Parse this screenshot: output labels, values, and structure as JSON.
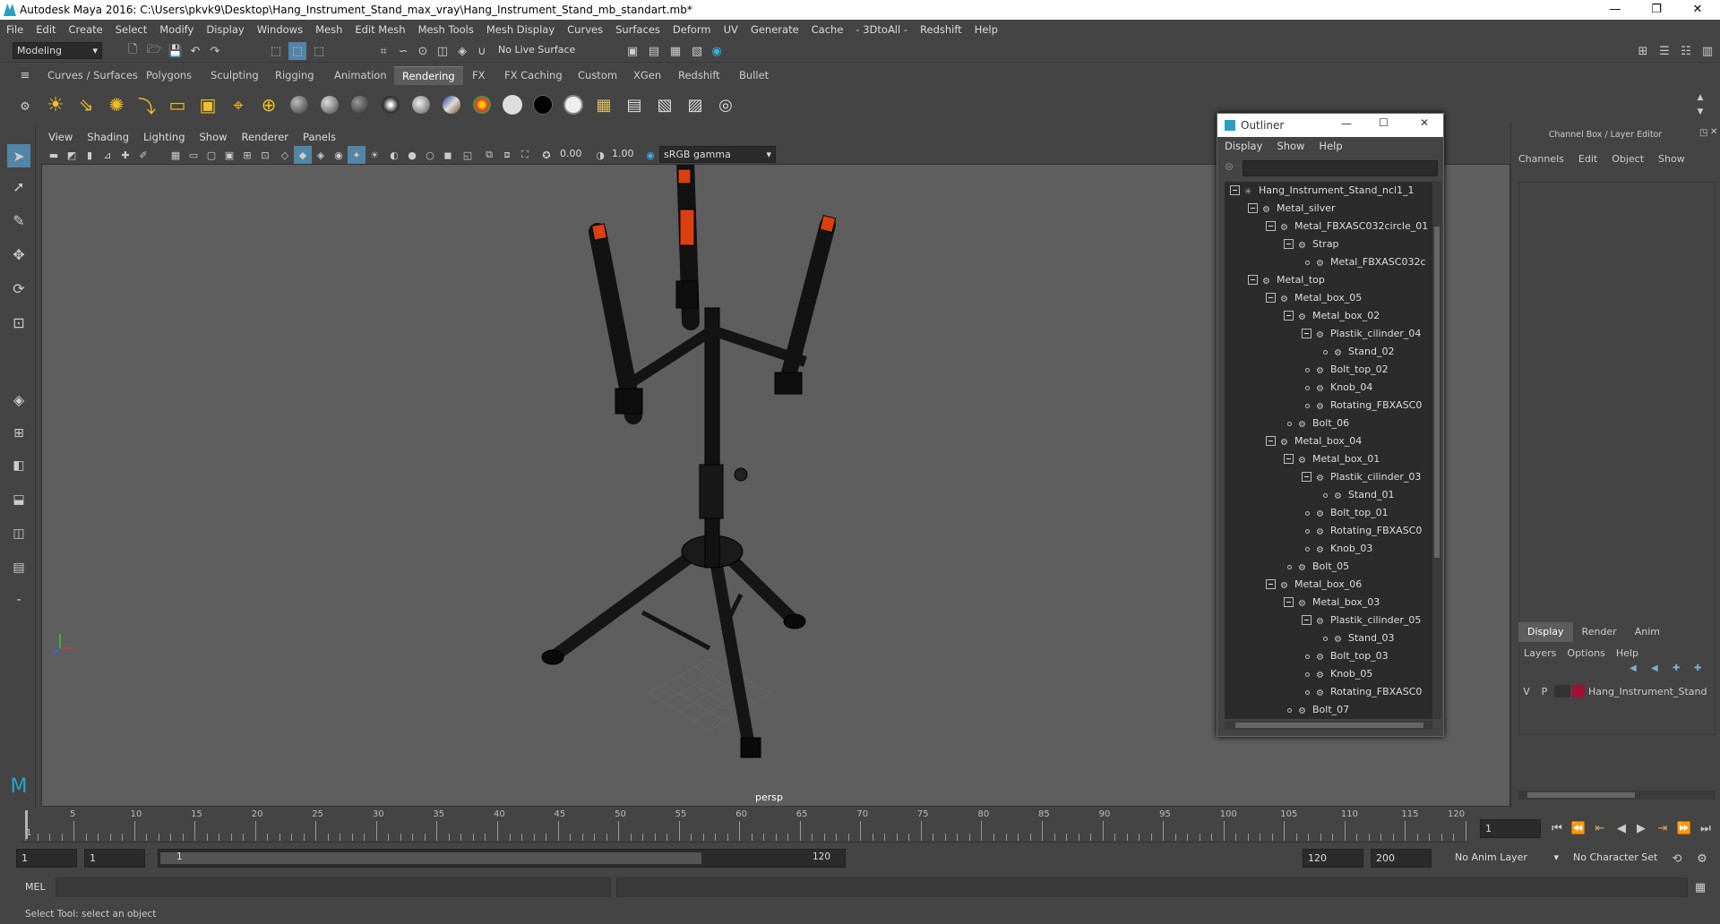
{
  "window": {
    "title": "Autodesk Maya 2016: C:\\Users\\pkvk9\\Desktop\\Hang_Instrument_Stand_max_vray\\Hang_Instrument_Stand_mb_standart.mb*",
    "minimize": "—",
    "maximize": "❐",
    "close": "✕"
  },
  "menubar": [
    "File",
    "Edit",
    "Create",
    "Select",
    "Modify",
    "Display",
    "Windows",
    "Mesh",
    "Edit Mesh",
    "Mesh Tools",
    "Mesh Display",
    "Curves",
    "Surfaces",
    "Deform",
    "UV",
    "Generate",
    "Cache",
    "- 3DtoAll -",
    "Redshift",
    "Help"
  ],
  "status": {
    "mode": "Modeling",
    "live_surface": "No Live Surface"
  },
  "shelf_tabs": [
    "Curves / Surfaces",
    "Polygons",
    "Sculpting",
    "Rigging",
    "Animation",
    "Rendering",
    "FX",
    "FX Caching",
    "Custom",
    "XGen",
    "Redshift",
    "Bullet"
  ],
  "shelf_active": "Rendering",
  "viewport": {
    "menu": [
      "View",
      "Shading",
      "Lighting",
      "Show",
      "Renderer",
      "Panels"
    ],
    "exposure": "0.00",
    "gamma": "1.00",
    "color_space": "sRGB gamma",
    "camera_label": "persp"
  },
  "outliner": {
    "title": "Outliner",
    "menu": [
      "Display",
      "Show",
      "Help"
    ],
    "items": [
      {
        "label": "Hang_Instrument_Stand_ncl1_1",
        "depth": 0,
        "expand": true
      },
      {
        "label": "Metal_silver",
        "depth": 1,
        "expand": true
      },
      {
        "label": "Metal_FBXASC032circle_01",
        "depth": 2,
        "expand": true
      },
      {
        "label": "Strap",
        "depth": 3,
        "expand": true
      },
      {
        "label": "Metal_FBXASC032c",
        "depth": 4,
        "expand": false
      },
      {
        "label": "Metal_top",
        "depth": 1,
        "expand": true
      },
      {
        "label": "Metal_box_05",
        "depth": 2,
        "expand": true
      },
      {
        "label": "Metal_box_02",
        "depth": 3,
        "expand": true
      },
      {
        "label": "Plastik_cilinder_04",
        "depth": 4,
        "expand": true
      },
      {
        "label": "Stand_02",
        "depth": 5,
        "expand": false
      },
      {
        "label": "Bolt_top_02",
        "depth": 4,
        "expand": false
      },
      {
        "label": "Knob_04",
        "depth": 4,
        "expand": false
      },
      {
        "label": "Rotating_FBXASC0",
        "depth": 4,
        "expand": false
      },
      {
        "label": "Bolt_06",
        "depth": 3,
        "expand": false
      },
      {
        "label": "Metal_box_04",
        "depth": 2,
        "expand": true
      },
      {
        "label": "Metal_box_01",
        "depth": 3,
        "expand": true
      },
      {
        "label": "Plastik_cilinder_03",
        "depth": 4,
        "expand": true
      },
      {
        "label": "Stand_01",
        "depth": 5,
        "expand": false
      },
      {
        "label": "Bolt_top_01",
        "depth": 4,
        "expand": false
      },
      {
        "label": "Rotating_FBXASC0",
        "depth": 4,
        "expand": false
      },
      {
        "label": "Knob_03",
        "depth": 4,
        "expand": false
      },
      {
        "label": "Bolt_05",
        "depth": 3,
        "expand": false
      },
      {
        "label": "Metal_box_06",
        "depth": 2,
        "expand": true
      },
      {
        "label": "Metal_box_03",
        "depth": 3,
        "expand": true
      },
      {
        "label": "Plastik_cilinder_05",
        "depth": 4,
        "expand": true
      },
      {
        "label": "Stand_03",
        "depth": 5,
        "expand": false
      },
      {
        "label": "Bolt_top_03",
        "depth": 4,
        "expand": false
      },
      {
        "label": "Knob_05",
        "depth": 4,
        "expand": false
      },
      {
        "label": "Rotating_FBXASC0",
        "depth": 4,
        "expand": false
      },
      {
        "label": "Bolt_07",
        "depth": 3,
        "expand": false
      }
    ]
  },
  "channelbox": {
    "title": "Channel Box / Layer Editor",
    "menu": [
      "Channels",
      "Edit",
      "Object",
      "Show"
    ],
    "tabs": [
      "Display",
      "Render",
      "Anim"
    ],
    "layer_menu": [
      "Layers",
      "Options",
      "Help"
    ],
    "layer": {
      "v": "V",
      "p": "P",
      "name": "Hang_Instrument_Stand",
      "color": "#a01030"
    }
  },
  "timeline": {
    "ticks": [
      "5",
      "10",
      "15",
      "20",
      "25",
      "30",
      "35",
      "40",
      "45",
      "50",
      "55",
      "60",
      "65",
      "70",
      "75",
      "80",
      "85",
      "90",
      "95",
      "100",
      "105",
      "110",
      "115",
      "120"
    ],
    "start_marker": "1",
    "current_frame": "1"
  },
  "range": {
    "start": "1",
    "start_inner": "1",
    "slider_start": "1",
    "slider_end": "120",
    "end_inner": "120",
    "end": "200",
    "anim_layer": "No Anim Layer",
    "character_set": "No Character Set"
  },
  "cmdline": {
    "lang": "MEL"
  },
  "helpline": "Select Tool: select an object"
}
